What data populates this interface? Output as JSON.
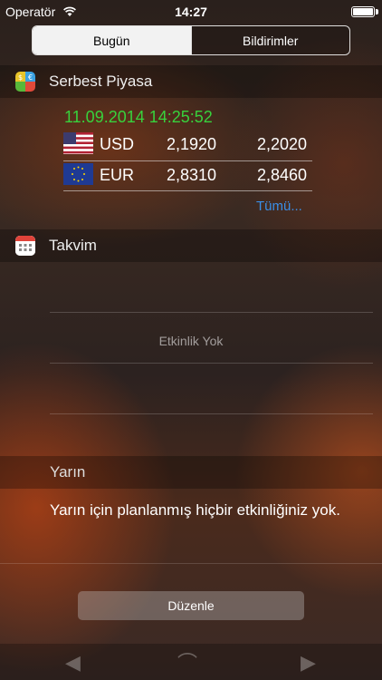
{
  "status_bar": {
    "carrier": "Operatör",
    "time": "14:27"
  },
  "tabs": {
    "today": "Bugün",
    "notifications": "Bildirimler"
  },
  "currency_widget": {
    "title": "Serbest Piyasa",
    "timestamp": "11.09.2014 14:25:52",
    "rows": [
      {
        "code": "USD",
        "buy": "2,1920",
        "sell": "2,2020",
        "flag": "us-flag"
      },
      {
        "code": "EUR",
        "buy": "2,8310",
        "sell": "2,8460",
        "flag": "eu-flag"
      }
    ],
    "more_link": "Tümü..."
  },
  "calendar_widget": {
    "title": "Takvim",
    "no_events": "Etkinlik Yok"
  },
  "tomorrow": {
    "title": "Yarın",
    "message": "Yarın için planlanmış hiçbir etkinliğiniz yok."
  },
  "edit_button": "Düzenle",
  "colors": {
    "timestamp_green": "#38d13c",
    "link_blue": "#3a8ee6"
  }
}
